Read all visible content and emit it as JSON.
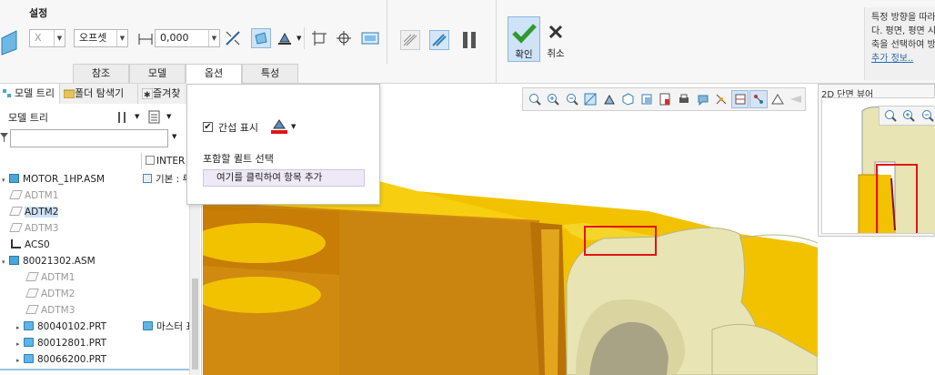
{
  "ribbon": {
    "title": "설정",
    "axis_value": "X",
    "offset_type": "오프셋",
    "offset_value": "0,000",
    "tabs": [
      "참조",
      "모델",
      "옵션",
      "특성"
    ],
    "ok_label": "확인",
    "cancel_label": "취소"
  },
  "help": {
    "lines": [
      "특정 방향을 따라",
      "다. 평면, 평면 시",
      "축을 선택하여 방"
    ],
    "link": "추가 정보.."
  },
  "left_panel": {
    "tabs": [
      "모델 트리",
      "폴더 탐색기",
      "즐겨찾"
    ],
    "header": "모델 트리",
    "column_header": "INTER",
    "tree": [
      {
        "label": "MOTOR_1HP.ASM",
        "col": "기본 : 루"
      },
      {
        "label": "ADTM1"
      },
      {
        "label": "ADTM2"
      },
      {
        "label": "ADTM3"
      },
      {
        "label": "ACS0"
      },
      {
        "label": "80021302.ASM"
      },
      {
        "label": "ADTM1"
      },
      {
        "label": "ADTM2"
      },
      {
        "label": "ADTM3"
      },
      {
        "label": "80040102.PRT",
        "col": "마스터 표"
      },
      {
        "label": "80012801.PRT"
      },
      {
        "label": "80066200.PRT"
      }
    ]
  },
  "popup": {
    "checkbox_label": "간섭 표시",
    "section_label": "포함할 퀼트 선택",
    "add_item": "여기를 클릭하여 항목 추가"
  },
  "viewer": {
    "title": "2D 단면 뷰어"
  },
  "colors": {
    "accent": "#2a6bb0",
    "highlight": "#e01515",
    "part_yellow": "#f2c200",
    "part_orange": "#d08a10",
    "part_cream": "#e8e4b4"
  }
}
